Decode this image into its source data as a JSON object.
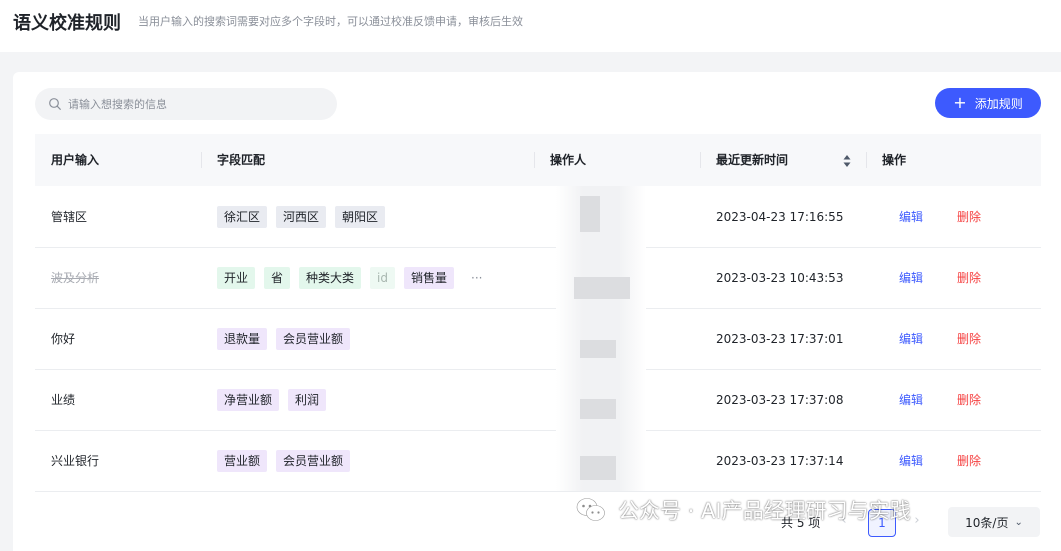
{
  "header": {
    "title": "语义校准规则",
    "description": "当用户输入的搜索词需要对应多个字段时，可以通过校准反馈申请，审核后生效"
  },
  "toolbar": {
    "search_placeholder": "请输入想搜索的信息",
    "add_label": "添加规则",
    "primary_color": "#3d5afe"
  },
  "table": {
    "columns": [
      "用户输入",
      "字段匹配",
      "操作人",
      "最近更新时间",
      "操作"
    ],
    "rows": [
      {
        "input": "管辖区",
        "tags": [
          "徐汇区",
          "河西区",
          "朝阳区"
        ],
        "updated": "2023-04-23 17:16:55",
        "edit": "编辑",
        "delete": "删除"
      },
      {
        "input": "波及分析",
        "tags": [
          "开业",
          "省",
          "种类大类",
          "id",
          "销售量"
        ],
        "more": "···",
        "updated": "2023-03-23 10:43:53",
        "edit": "编辑",
        "delete": "删除"
      },
      {
        "input": "你好",
        "tags": [
          "退款量",
          "会员营业额"
        ],
        "updated": "2023-03-23 17:37:01",
        "edit": "编辑",
        "delete": "删除"
      },
      {
        "input": "业绩",
        "tags": [
          "净营业额",
          "利润"
        ],
        "updated": "2023-03-23 17:37:08",
        "edit": "编辑",
        "delete": "删除"
      },
      {
        "input": "兴业银行",
        "tags": [
          "营业额",
          "会员营业额"
        ],
        "updated": "2023-03-23 17:37:14",
        "edit": "编辑",
        "delete": "删除"
      }
    ]
  },
  "pagination": {
    "total": "共 5 项",
    "prev": "‹",
    "current_page": "1",
    "next": "›",
    "page_size": "10条/页"
  },
  "watermark": {
    "text": "公众号 · AI产品经理研习与实践"
  }
}
